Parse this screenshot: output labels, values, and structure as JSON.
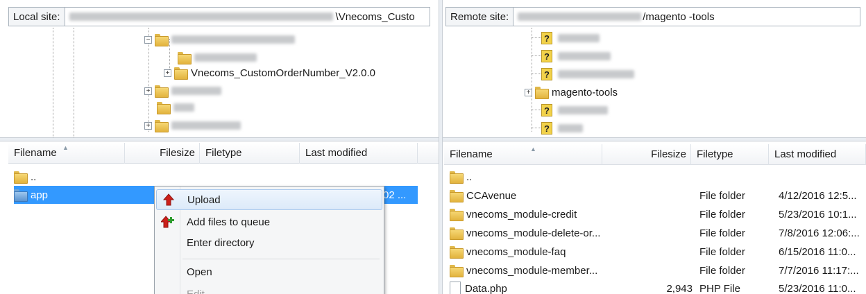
{
  "local": {
    "site_label": "Local site:",
    "site_path_suffix": "\\Vnecoms_Custo",
    "tree": {
      "visible_folder": "Vnecoms_CustomOrderNumber_V2.0.0"
    },
    "columns": {
      "filename": "Filename",
      "filesize": "Filesize",
      "filetype": "Filetype",
      "last_modified": "Last modified"
    },
    "rows": [
      {
        "name": "..",
        "icon": "folder-icon"
      },
      {
        "name": "app",
        "icon": "folder-icon",
        "modified_partial": "02 ...",
        "selected": true
      }
    ]
  },
  "remote": {
    "site_label": "Remote site:",
    "site_path_suffix": "/magento -tools",
    "tree": {
      "visible_folder": "magento-tools"
    },
    "columns": {
      "filename": "Filename",
      "filesize": "Filesize",
      "filetype": "Filetype",
      "last_modified": "Last modified"
    },
    "rows": [
      {
        "name": "..",
        "size": "",
        "type": "",
        "modified": "",
        "icon": "folder-icon"
      },
      {
        "name": "CCAvenue",
        "size": "",
        "type": "File folder",
        "modified": "4/12/2016 12:5...",
        "icon": "folder-icon"
      },
      {
        "name": "vnecoms_module-credit",
        "size": "",
        "type": "File folder",
        "modified": "5/23/2016 10:1...",
        "icon": "folder-icon"
      },
      {
        "name": "vnecoms_module-delete-or...",
        "size": "",
        "type": "File folder",
        "modified": "7/8/2016 12:06:...",
        "icon": "folder-icon"
      },
      {
        "name": "vnecoms_module-faq",
        "size": "",
        "type": "File folder",
        "modified": "6/15/2016 11:0...",
        "icon": "folder-icon"
      },
      {
        "name": "vnecoms_module-member...",
        "size": "",
        "type": "File folder",
        "modified": "7/7/2016 11:17:...",
        "icon": "folder-icon"
      },
      {
        "name": "Data.php",
        "size": "2,943",
        "type": "PHP File",
        "modified": "5/23/2016 11:0...",
        "icon": "file-icon"
      }
    ]
  },
  "context_menu": {
    "items": [
      {
        "label": "Upload",
        "icon": "upload-arrow-icon"
      },
      {
        "label": "Add files to queue",
        "icon": "add-to-queue-icon"
      },
      {
        "label": "Enter directory",
        "icon": ""
      },
      {
        "label": "Open",
        "icon": ""
      },
      {
        "label": "Edit",
        "icon": "",
        "disabled": true
      }
    ]
  },
  "colors": {
    "selection": "#3399ff",
    "upload_arrow": "#cc1f1a",
    "queue_plus": "#2e9b2e"
  }
}
